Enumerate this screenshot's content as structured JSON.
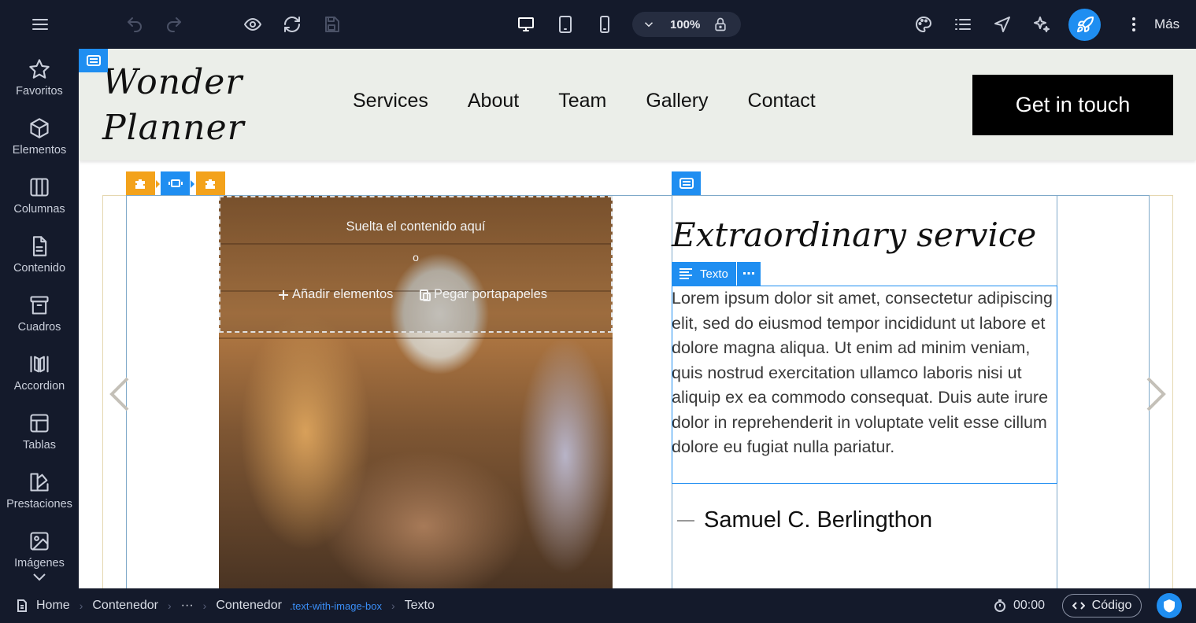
{
  "toolbar": {
    "zoom": "100%",
    "more_label": "Más",
    "icons": [
      "menu-icon",
      "undo-icon",
      "redo-icon",
      "preview-eye-icon",
      "refresh-icon",
      "save-icon",
      "desktop-icon",
      "tablet-icon",
      "mobile-icon",
      "chevron-down-icon",
      "lock-icon",
      "palette-icon",
      "list-icon",
      "navigation-icon",
      "sparkle-icon",
      "rocket-icon",
      "more-dots-icon"
    ]
  },
  "sidebar": {
    "items": [
      {
        "label": "Favoritos",
        "icon": "star-icon"
      },
      {
        "label": "Elementos",
        "icon": "cube-icon"
      },
      {
        "label": "Columnas",
        "icon": "columns-icon"
      },
      {
        "label": "Contenido",
        "icon": "document-icon"
      },
      {
        "label": "Cuadros",
        "icon": "archive-icon"
      },
      {
        "label": "Accordion",
        "icon": "accordion-icon"
      },
      {
        "label": "Tablas",
        "icon": "table-icon"
      },
      {
        "label": "Prestaciones",
        "icon": "features-icon"
      },
      {
        "label": "Imágenes",
        "icon": "image-icon"
      }
    ]
  },
  "site": {
    "logo_line1": "Wonder",
    "logo_line2": "Planner",
    "nav": [
      "Services",
      "About",
      "Team",
      "Gallery",
      "Contact"
    ],
    "cta": "Get in touch"
  },
  "dropzone": {
    "title": "Suelta el contenido aquí",
    "or": "o",
    "add": "Añadir elementos",
    "paste": "Pegar portapapeles"
  },
  "content": {
    "title": "Extraordinary service",
    "texto_label": "Texto",
    "body": "Lorem ipsum dolor sit amet, consectetur adipiscing elit, sed do eiusmod tempor incididunt ut labore et dolore magna aliqua. Ut enim ad minim veniam, quis nostrud exercitation ullamco laboris nisi ut aliquip ex ea commodo consequat. Duis aute irure dolor in reprehenderit in voluptate velit esse cillum dolore eu fugiat nulla pariatur.",
    "author": "Samuel C. Berlingthon"
  },
  "statusbar": {
    "crumbs": [
      "Home",
      "Contenedor",
      "···",
      "Contenedor"
    ],
    "crumb_class": ".text-with-image-box",
    "current": "Texto",
    "timer": "00:00",
    "code_label": "Código"
  },
  "colors": {
    "accent": "#1f8ef1",
    "badge_orange": "#f3a21b",
    "chrome_bg": "#141a2b",
    "header_bg": "#ebeee9"
  }
}
